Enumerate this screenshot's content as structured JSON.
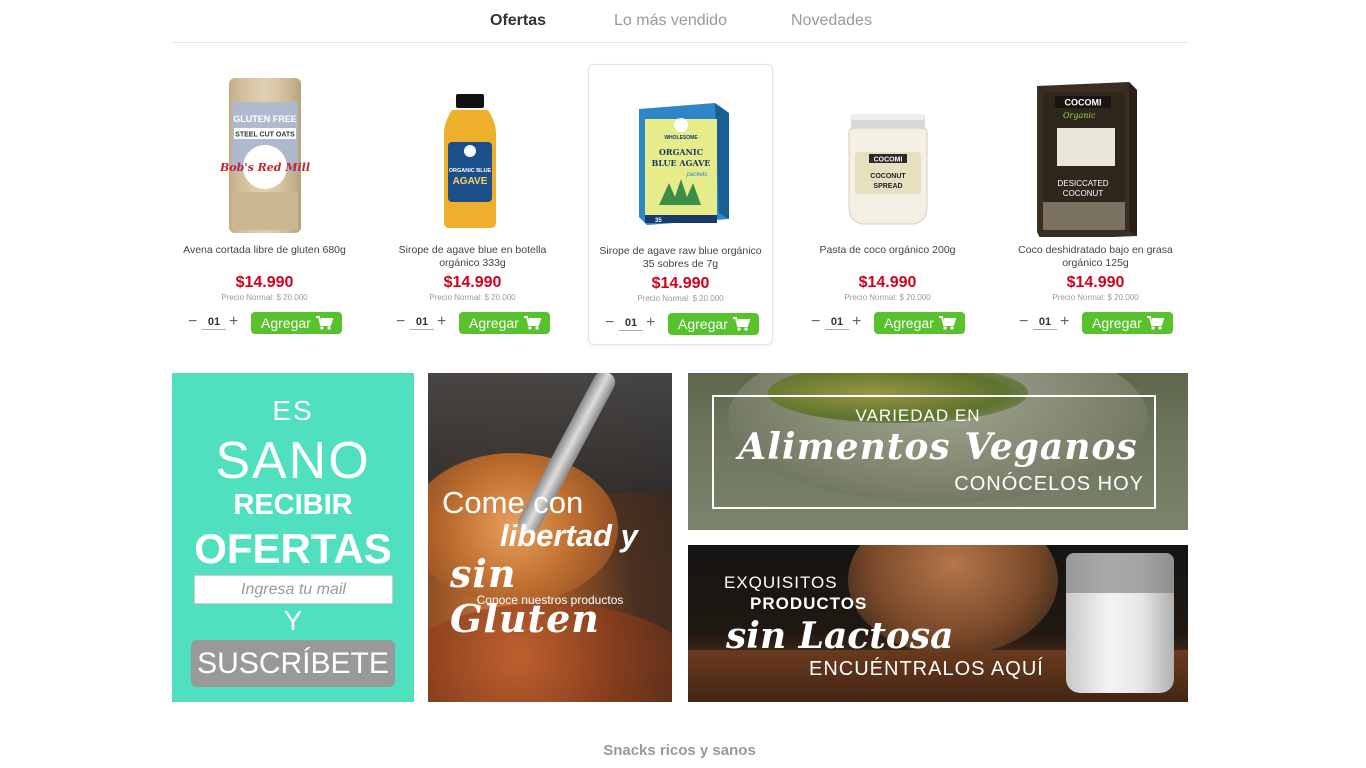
{
  "tabs": [
    {
      "label": "Ofertas",
      "active": true
    },
    {
      "label": "Lo más vendido",
      "active": false
    },
    {
      "label": "Novedades",
      "active": false
    }
  ],
  "products": [
    {
      "name": "Avena cortada libre de gluten 680g",
      "price": "$14.990",
      "normal_price": "Precio Normal: $ 20.000",
      "qty": "01",
      "add_label": "Agregar",
      "image": "oats-bag"
    },
    {
      "name": "Sirope de agave blue en botella orgánico 333g",
      "price": "$14.990",
      "normal_price": "Precio Normal: $ 20.000",
      "qty": "01",
      "add_label": "Agregar",
      "image": "agave-bottle"
    },
    {
      "name": "Sirope de agave raw blue orgánico 35 sobres de 7g",
      "price": "$14.990",
      "normal_price": "Precio Normal: $ 20.000",
      "qty": "01",
      "add_label": "Agregar",
      "image": "agave-box"
    },
    {
      "name": "Pasta de coco orgánico 200g",
      "price": "$14.990",
      "normal_price": "Precio Normal: $ 20.000",
      "qty": "01",
      "add_label": "Agregar",
      "image": "coconut-jar"
    },
    {
      "name": "Coco deshidratado bajo en grasa orgánico 125g",
      "price": "$14.990",
      "normal_price": "Precio Normal: $ 20.000",
      "qty": "01",
      "add_label": "Agregar",
      "image": "coconut-box"
    }
  ],
  "product_labels": {
    "oats": {
      "brand": "Bob's Red Mill",
      "line1": "GLUTEN FREE",
      "line2": "STEEL CUT OATS"
    },
    "agave_bottle": {
      "line1": "ORGANIC BLUE",
      "line2": "AGAVE"
    },
    "agave_box": {
      "brand": "WHOLESOME",
      "line1": "ORGANIC",
      "line2": "BLUE AGAVE",
      "line3": "packets",
      "count": "35"
    },
    "coconut_jar": {
      "brand": "COCOMI",
      "line1": "COCONUT",
      "line2": "SPREAD"
    },
    "coconut_box": {
      "brand": "COCOMI",
      "line1": "Organic",
      "line2": "DESICCATED",
      "line3": "COCONUT"
    }
  },
  "newsletter": {
    "line1": "ES",
    "line2": "SANO",
    "line3": "RECIBIR",
    "line4": "OFERTAS",
    "placeholder": "Ingresa tu mail",
    "connector": "Y",
    "button": "SUSCRÍBETE",
    "bg_color": "#50e0c0"
  },
  "banner_gluten": {
    "line1": "Come con",
    "line2": "libertad y",
    "line3": "sin Gluten",
    "subtitle": "Conoce nuestros productos"
  },
  "banner_vegan": {
    "line1": "VARIEDAD EN",
    "line2": "Alimentos Veganos",
    "line3": "CONÓCELOS HOY"
  },
  "banner_lactosa": {
    "line1": "EXQUISITOS",
    "line2": "PRODUCTOS",
    "line3": "sin Lactosa",
    "line4": "ENCUÉNTRALOS AQUÍ"
  },
  "section_title": "Snacks ricos y sanos",
  "colors": {
    "accent_green": "#58c22d",
    "price_red": "#d0021b"
  }
}
